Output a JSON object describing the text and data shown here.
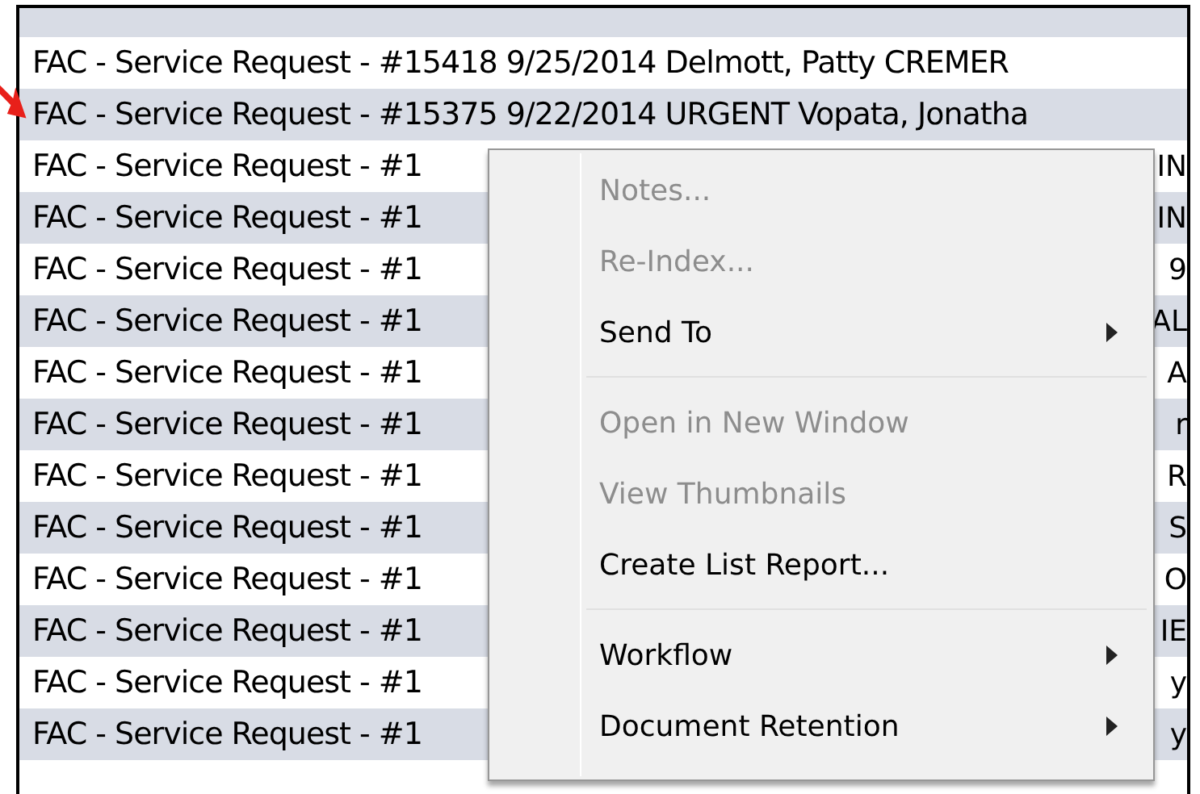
{
  "list": {
    "rows": [
      {
        "text": "",
        "tail": ""
      },
      {
        "text": "FAC - Service Request - #15418 9/25/2014  Delmott, Patty  CREMER",
        "tail": ""
      },
      {
        "text": "FAC - Service Request - #15375 9/22/2014 URGENT Vopata, Jonatha",
        "tail": ""
      },
      {
        "text": "FAC - Service Request - #1",
        "tail": "IN"
      },
      {
        "text": "FAC - Service Request - #1",
        "tail": "IN"
      },
      {
        "text": "FAC - Service Request - #1",
        "tail": "9"
      },
      {
        "text": "FAC - Service Request - #1",
        "tail": "AL"
      },
      {
        "text": "FAC - Service Request - #1",
        "tail": "A"
      },
      {
        "text": "FAC - Service Request - #1",
        "tail": "r"
      },
      {
        "text": "FAC - Service Request - #1",
        "tail": "R"
      },
      {
        "text": "FAC - Service Request - #1",
        "tail": "S"
      },
      {
        "text": "FAC - Service Request - #1",
        "tail": "O"
      },
      {
        "text": "FAC - Service Request - #1",
        "tail": "IE"
      },
      {
        "text": "FAC - Service Request - #1",
        "tail": "y"
      },
      {
        "text": "FAC - Service Request - #1",
        "tail": "y"
      },
      {
        "text": "",
        "tail": ""
      }
    ]
  },
  "context_menu": {
    "items": [
      {
        "kind": "item",
        "label": "Notes...",
        "disabled": true,
        "submenu": false
      },
      {
        "kind": "item",
        "label": "Re-Index...",
        "disabled": true,
        "submenu": false
      },
      {
        "kind": "item",
        "label": "Send To",
        "disabled": false,
        "submenu": true
      },
      {
        "kind": "separator"
      },
      {
        "kind": "item",
        "label": "Open in New Window",
        "disabled": true,
        "submenu": false
      },
      {
        "kind": "item",
        "label": "View Thumbnails",
        "disabled": true,
        "submenu": false
      },
      {
        "kind": "item",
        "label": "Create List Report...",
        "disabled": false,
        "submenu": false
      },
      {
        "kind": "separator"
      },
      {
        "kind": "item",
        "label": "Workflow",
        "disabled": false,
        "submenu": true
      },
      {
        "kind": "item",
        "label": "Document Retention",
        "disabled": false,
        "submenu": true
      }
    ]
  }
}
